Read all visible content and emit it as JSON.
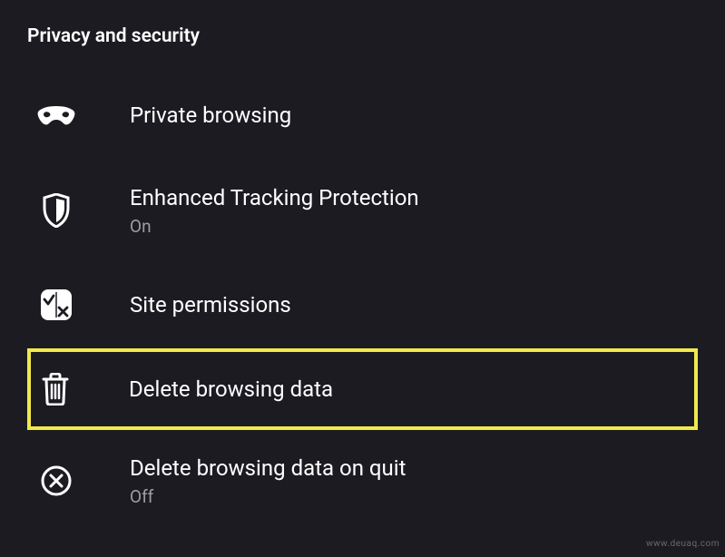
{
  "section": {
    "title": "Privacy and security"
  },
  "items": [
    {
      "title": "Private browsing",
      "status": ""
    },
    {
      "title": "Enhanced Tracking Protection",
      "status": "On"
    },
    {
      "title": "Site permissions",
      "status": ""
    },
    {
      "title": "Delete browsing data",
      "status": ""
    },
    {
      "title": "Delete browsing data on quit",
      "status": "Off"
    }
  ],
  "watermark": "www.deuaq.com"
}
